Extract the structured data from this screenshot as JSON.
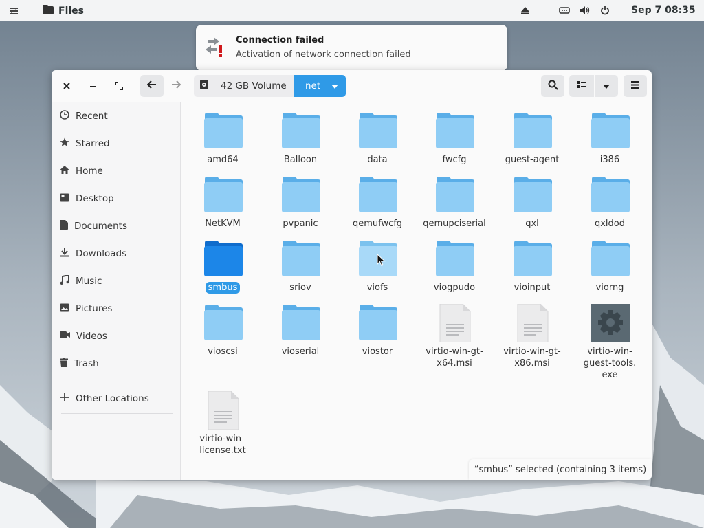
{
  "topbar": {
    "app_name": "Files",
    "clock": "Sep 7  08:35",
    "icons": [
      "menu-icon",
      "folder-icon",
      "eject-icon",
      "network-icon",
      "volume-icon",
      "power-icon"
    ]
  },
  "notification": {
    "title": "Connection failed",
    "body": "Activation of network connection failed",
    "icon": "network-error-icon"
  },
  "headerbar": {
    "path": [
      "42 GB Volume",
      "net"
    ],
    "icons": [
      "close-icon",
      "minimize-icon",
      "maximize-icon",
      "back-icon",
      "forward-icon",
      "drive-icon",
      "dropdown-icon",
      "search-icon",
      "list-view-icon",
      "view-options-icon",
      "menu-icon"
    ]
  },
  "sidebar": {
    "items": [
      {
        "label": "Recent",
        "icon": "clock-icon"
      },
      {
        "label": "Starred",
        "icon": "star-icon"
      },
      {
        "label": "Home",
        "icon": "home-icon"
      },
      {
        "label": "Desktop",
        "icon": "desktop-icon"
      },
      {
        "label": "Documents",
        "icon": "document-icon"
      },
      {
        "label": "Downloads",
        "icon": "download-icon"
      },
      {
        "label": "Music",
        "icon": "music-icon"
      },
      {
        "label": "Pictures",
        "icon": "picture-icon"
      },
      {
        "label": "Videos",
        "icon": "video-icon"
      },
      {
        "label": "Trash",
        "icon": "trash-icon"
      }
    ],
    "other": {
      "label": "Other Locations",
      "icon": "plus-icon"
    }
  },
  "files": [
    {
      "name": "amd64",
      "type": "folder"
    },
    {
      "name": "Balloon",
      "type": "folder"
    },
    {
      "name": "data",
      "type": "folder"
    },
    {
      "name": "fwcfg",
      "type": "folder"
    },
    {
      "name": "guest-agent",
      "type": "folder"
    },
    {
      "name": "i386",
      "type": "folder"
    },
    {
      "name": "NetKVM",
      "type": "folder"
    },
    {
      "name": "pvpanic",
      "type": "folder"
    },
    {
      "name": "qemufwcfg",
      "type": "folder"
    },
    {
      "name": "qemupciserial",
      "type": "folder"
    },
    {
      "name": "qxl",
      "type": "folder"
    },
    {
      "name": "qxldod",
      "type": "folder"
    },
    {
      "name": "smbus",
      "type": "folder",
      "selected": true
    },
    {
      "name": "sriov",
      "type": "folder"
    },
    {
      "name": "viofs",
      "type": "folder"
    },
    {
      "name": "viogpudo",
      "type": "folder"
    },
    {
      "name": "vioinput",
      "type": "folder"
    },
    {
      "name": "viorng",
      "type": "folder"
    },
    {
      "name": "vioscsi",
      "type": "folder"
    },
    {
      "name": "vioserial",
      "type": "folder"
    },
    {
      "name": "viostor",
      "type": "folder"
    },
    {
      "name": "virtio-win-gt-x64.msi",
      "line1": "virtio-win-gt-",
      "line2": "x64.msi",
      "type": "text"
    },
    {
      "name": "virtio-win-gt-x86.msi",
      "line1": "virtio-win-gt-",
      "line2": "x86.msi",
      "type": "text"
    },
    {
      "name": "virtio-win-guest-tools.exe",
      "line1": "virtio-win-",
      "line2": "guest-tools.",
      "line3": "exe",
      "type": "exe"
    },
    {
      "name": "virtio-win_license.txt",
      "line1": "virtio-win_",
      "line2": "license.txt",
      "type": "text"
    }
  ],
  "status": "“smbus” selected  (containing 3 items)",
  "colors": {
    "accent": "#2f9ae7",
    "folder": "#8fcdf5",
    "folder_selected": "#1c86e8"
  }
}
